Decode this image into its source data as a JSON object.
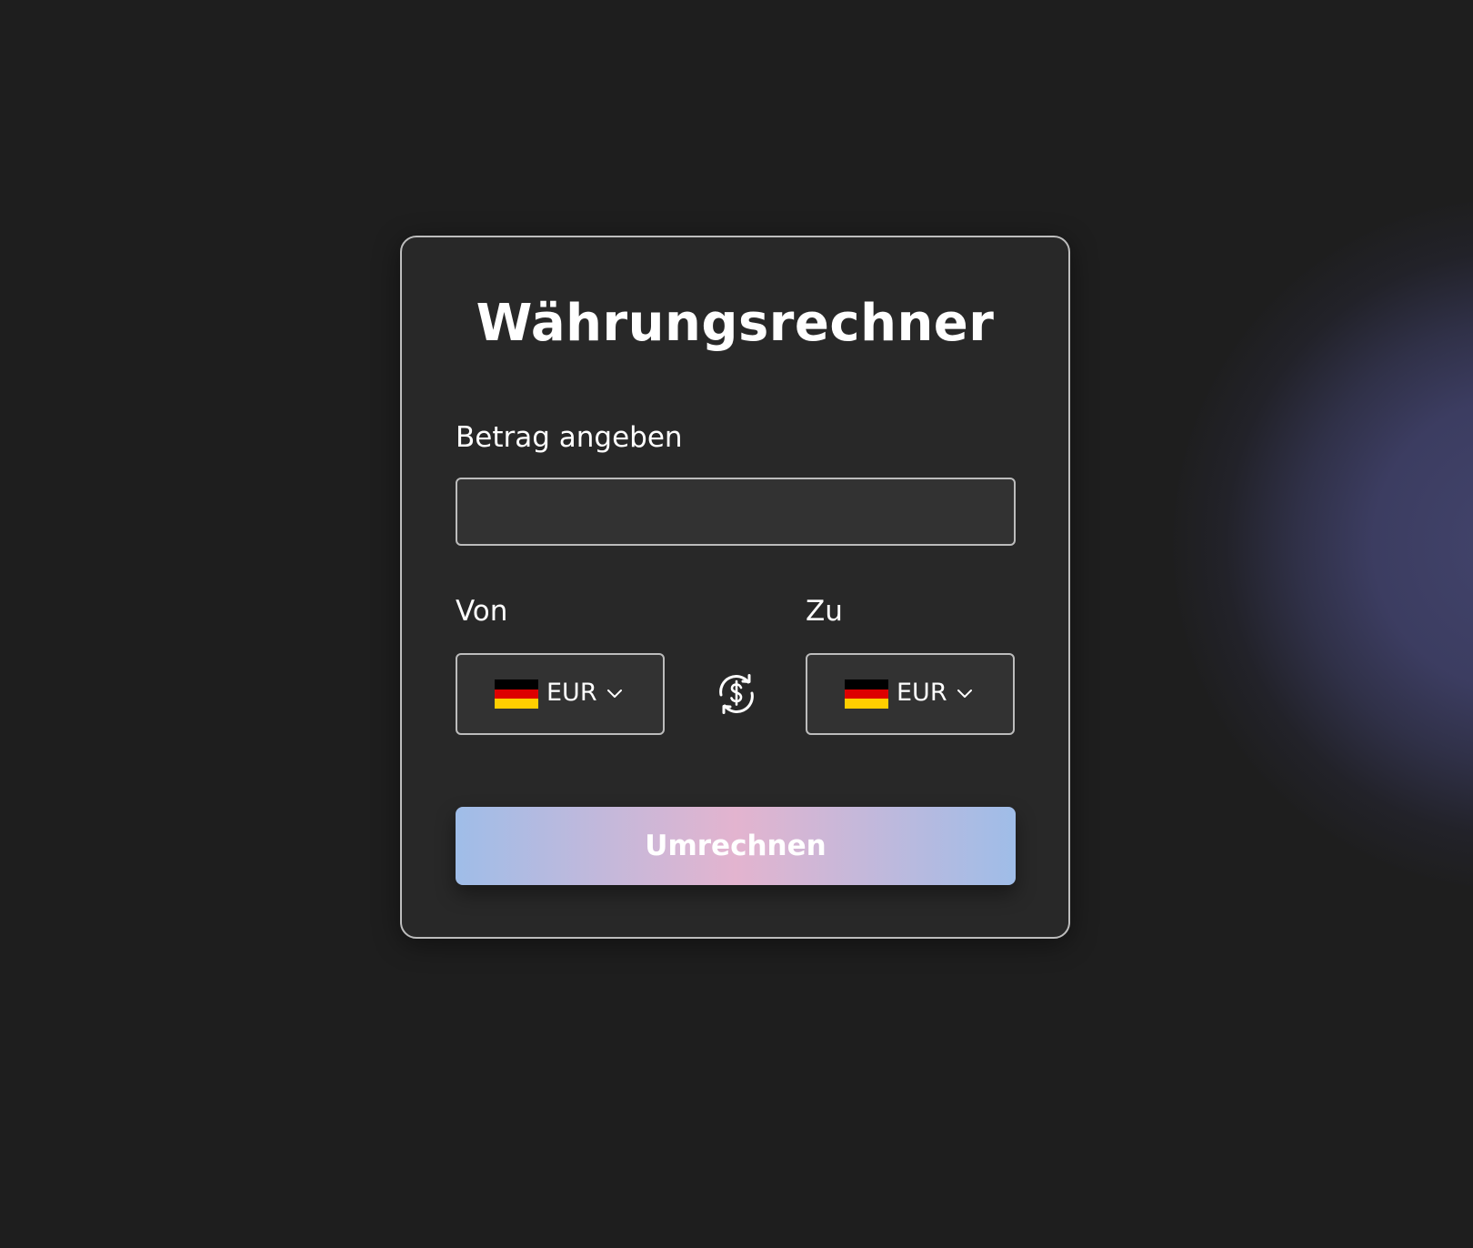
{
  "page": {
    "title": "Währungsrechner",
    "background_color": "#1e1e1e",
    "card_color": "#282828",
    "accent_gradient": [
      "#9fbde8",
      "#e3b4cf",
      "#9fbde8"
    ]
  },
  "amount": {
    "label": "Betrag angeben",
    "value": "",
    "placeholder": ""
  },
  "from": {
    "label": "Von",
    "currency": "EUR",
    "flag": "germany-flag-icon"
  },
  "to": {
    "label": "Zu",
    "currency": "EUR",
    "flag": "germany-flag-icon"
  },
  "swap": {
    "icon": "currency-swap-icon"
  },
  "convert_button": {
    "label": "Umrechnen"
  }
}
